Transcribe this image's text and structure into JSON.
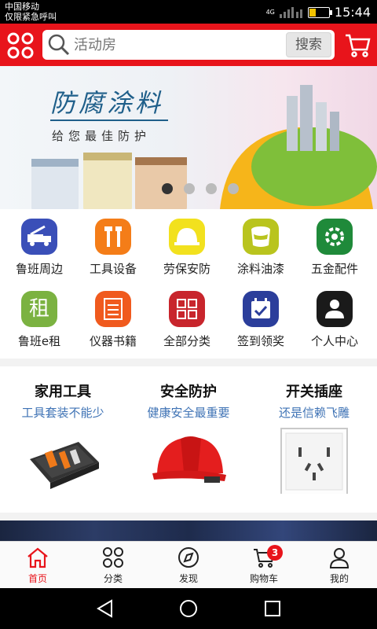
{
  "status_bar": {
    "carrier": "中国移动",
    "emergency": "仅限紧急呼叫",
    "network": "4G",
    "time": "15:44",
    "battery_level": 0.35
  },
  "top_bar": {
    "logo_icon": "clover-logo-icon",
    "search_placeholder": "活动房",
    "search_button": "搜索",
    "cart_icon": "cart-icon",
    "accent_color": "#e8141b"
  },
  "banner": {
    "title": "防腐涂料",
    "subtitle": "给您最佳防护",
    "dot_count": 4,
    "active_dot": 0
  },
  "categories": [
    {
      "label": "鲁班周边",
      "icon": "truck-icon",
      "color": "#3a4fb8"
    },
    {
      "label": "工具设备",
      "icon": "tools-icon",
      "color": "#f47d18"
    },
    {
      "label": "劳保安防",
      "icon": "helmet-icon",
      "color": "#f2e11e"
    },
    {
      "label": "涂料油漆",
      "icon": "paint-bucket-icon",
      "color": "#b9c41e"
    },
    {
      "label": "五金配件",
      "icon": "gear-icon",
      "color": "#1f8a3a"
    },
    {
      "label": "鲁班e租",
      "icon": "rent-icon",
      "color": "#7bb241"
    },
    {
      "label": "仪器书籍",
      "icon": "chart-book-icon",
      "color": "#f05a1e"
    },
    {
      "label": "全部分类",
      "icon": "grid-icon",
      "color": "#c8252c"
    },
    {
      "label": "签到领奖",
      "icon": "calendar-check-icon",
      "color": "#2b3e9b"
    },
    {
      "label": "个人中心",
      "icon": "person-icon",
      "color": "#1a1a1a"
    }
  ],
  "rent_glyph": "租",
  "promos": [
    {
      "title": "家用工具",
      "subtitle": "工具套装不能少",
      "icon": "toolkit-image"
    },
    {
      "title": "安全防护",
      "subtitle": "健康安全最重要",
      "icon": "red-helmet-image"
    },
    {
      "title": "开关插座",
      "subtitle": "还是信赖飞雕",
      "icon": "wall-socket-image"
    }
  ],
  "tabs": [
    {
      "label": "首页",
      "icon": "home-icon",
      "active": true
    },
    {
      "label": "分类",
      "icon": "category-icon",
      "active": false
    },
    {
      "label": "发现",
      "icon": "compass-icon",
      "active": false
    },
    {
      "label": "购物车",
      "icon": "cart-icon",
      "active": false,
      "badge": "3"
    },
    {
      "label": "我的",
      "icon": "user-icon",
      "active": false
    }
  ],
  "nav": [
    "back-icon",
    "home-circle-icon",
    "recents-icon"
  ]
}
